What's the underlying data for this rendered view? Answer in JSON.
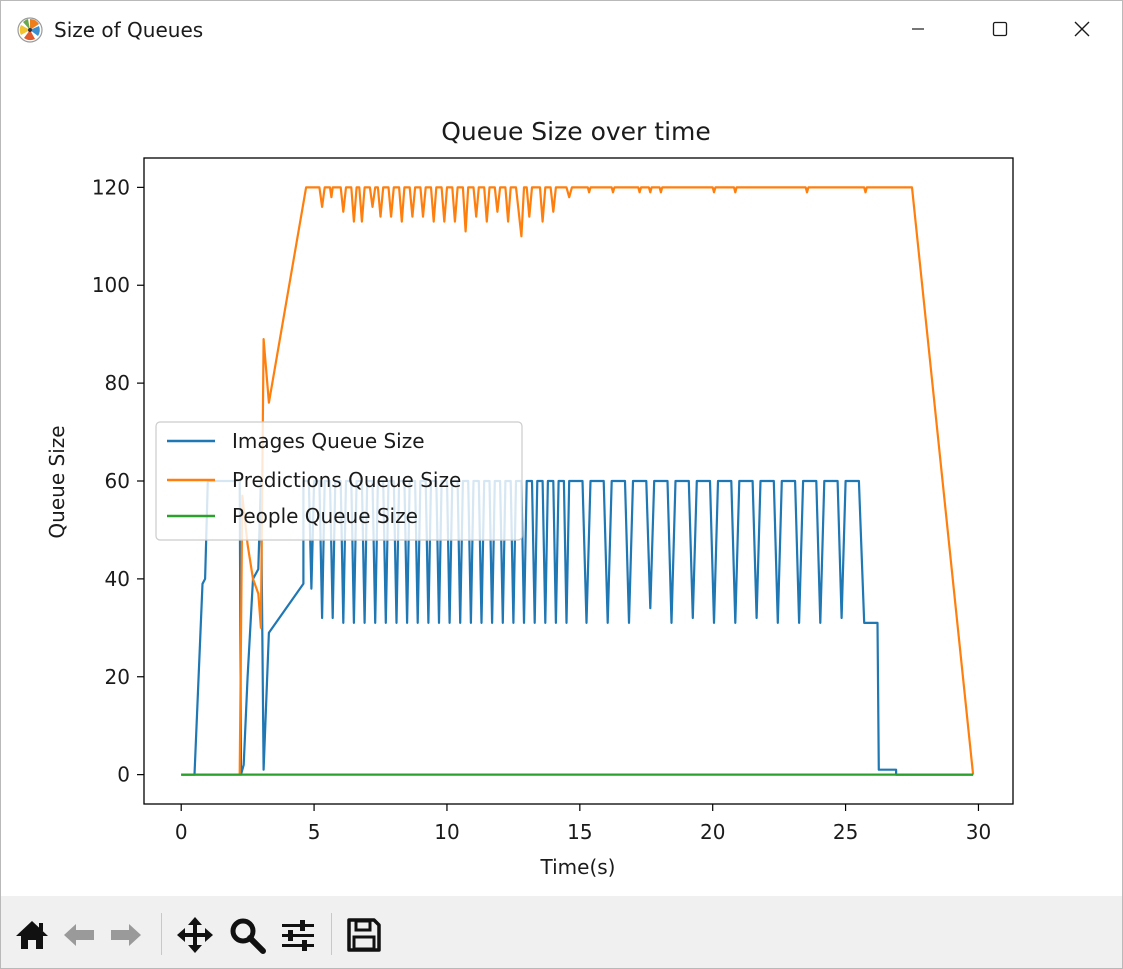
{
  "window": {
    "title": "Size of Queues",
    "controls": [
      "minimize-icon",
      "maximize-icon",
      "close-icon"
    ]
  },
  "toolbar": {
    "buttons": [
      "home-icon",
      "back-icon",
      "forward-icon",
      "pan-icon",
      "zoom-icon",
      "configure-subplots-icon",
      "save-icon"
    ]
  },
  "chart_data": {
    "type": "line",
    "title": "Queue Size over time",
    "xlabel": "Time(s)",
    "ylabel": "Queue Size",
    "xlim": [
      -1.4,
      31.3
    ],
    "ylim": [
      -6,
      126
    ],
    "xticks": [
      0,
      5,
      10,
      15,
      20,
      25,
      30
    ],
    "yticks": [
      0,
      20,
      40,
      60,
      80,
      100,
      120
    ],
    "grid": false,
    "legend": "center-left",
    "colors": {
      "images": "#1f77b4",
      "predictions": "#ff7f0e",
      "people": "#2ca02c",
      "axes": "#000000"
    },
    "series": [
      {
        "name": "Images Queue Size",
        "key": "images",
        "points": [
          [
            0,
            0
          ],
          [
            0.4,
            0
          ],
          [
            0.5,
            0
          ],
          [
            0.8,
            39
          ],
          [
            0.9,
            40
          ],
          [
            1.0,
            60
          ],
          [
            2.2,
            60
          ],
          [
            2.25,
            0
          ],
          [
            2.35,
            2
          ],
          [
            2.5,
            20
          ],
          [
            2.7,
            40
          ],
          [
            2.9,
            42
          ],
          [
            3.0,
            60
          ],
          [
            3.1,
            1
          ],
          [
            3.3,
            29
          ],
          [
            4.6,
            39
          ],
          [
            4.6,
            60
          ],
          [
            4.8,
            60
          ],
          [
            4.9,
            38
          ],
          [
            5.0,
            60
          ],
          [
            5.2,
            60
          ],
          [
            5.3,
            32
          ],
          [
            5.4,
            60
          ],
          [
            5.6,
            60
          ],
          [
            5.7,
            32
          ],
          [
            5.8,
            60
          ],
          [
            6.0,
            60
          ],
          [
            6.1,
            31
          ],
          [
            6.2,
            60
          ],
          [
            6.4,
            60
          ],
          [
            6.5,
            31
          ],
          [
            6.6,
            60
          ],
          [
            6.8,
            60
          ],
          [
            6.9,
            31
          ],
          [
            7.0,
            60
          ],
          [
            7.2,
            60
          ],
          [
            7.3,
            31
          ],
          [
            7.4,
            60
          ],
          [
            7.6,
            60
          ],
          [
            7.7,
            31
          ],
          [
            7.8,
            60
          ],
          [
            8.0,
            60
          ],
          [
            8.1,
            31
          ],
          [
            8.2,
            60
          ],
          [
            8.4,
            60
          ],
          [
            8.5,
            31
          ],
          [
            8.6,
            60
          ],
          [
            8.8,
            60
          ],
          [
            8.9,
            31
          ],
          [
            9.0,
            60
          ],
          [
            9.2,
            60
          ],
          [
            9.3,
            31
          ],
          [
            9.4,
            60
          ],
          [
            9.6,
            60
          ],
          [
            9.7,
            31
          ],
          [
            9.8,
            60
          ],
          [
            10.0,
            60
          ],
          [
            10.1,
            31
          ],
          [
            10.2,
            60
          ],
          [
            10.4,
            60
          ],
          [
            10.5,
            31
          ],
          [
            10.6,
            60
          ],
          [
            10.8,
            60
          ],
          [
            10.9,
            31
          ],
          [
            11.0,
            60
          ],
          [
            11.2,
            60
          ],
          [
            11.3,
            31
          ],
          [
            11.4,
            60
          ],
          [
            11.6,
            60
          ],
          [
            11.7,
            31
          ],
          [
            11.8,
            60
          ],
          [
            12.0,
            60
          ],
          [
            12.1,
            31
          ],
          [
            12.2,
            60
          ],
          [
            12.4,
            60
          ],
          [
            12.5,
            31
          ],
          [
            12.6,
            60
          ],
          [
            12.8,
            60
          ],
          [
            12.9,
            31
          ],
          [
            13.0,
            60
          ],
          [
            13.2,
            60
          ],
          [
            13.3,
            31
          ],
          [
            13.4,
            60
          ],
          [
            13.6,
            60
          ],
          [
            13.7,
            31
          ],
          [
            13.8,
            60
          ],
          [
            14.0,
            60
          ],
          [
            14.1,
            31
          ],
          [
            14.2,
            60
          ],
          [
            14.4,
            60
          ],
          [
            14.5,
            31
          ],
          [
            14.6,
            60
          ],
          [
            15.1,
            60
          ],
          [
            15.25,
            31
          ],
          [
            15.4,
            60
          ],
          [
            15.9,
            60
          ],
          [
            16.05,
            31
          ],
          [
            16.2,
            60
          ],
          [
            16.7,
            60
          ],
          [
            16.85,
            31
          ],
          [
            17.0,
            60
          ],
          [
            17.5,
            60
          ],
          [
            17.65,
            34
          ],
          [
            17.8,
            60
          ],
          [
            18.3,
            60
          ],
          [
            18.45,
            31
          ],
          [
            18.6,
            60
          ],
          [
            19.1,
            60
          ],
          [
            19.25,
            32
          ],
          [
            19.4,
            60
          ],
          [
            19.9,
            60
          ],
          [
            20.05,
            31
          ],
          [
            20.2,
            60
          ],
          [
            20.7,
            60
          ],
          [
            20.85,
            31
          ],
          [
            21.0,
            60
          ],
          [
            21.5,
            60
          ],
          [
            21.65,
            32
          ],
          [
            21.8,
            60
          ],
          [
            22.3,
            60
          ],
          [
            22.45,
            31
          ],
          [
            22.6,
            60
          ],
          [
            23.1,
            60
          ],
          [
            23.25,
            31
          ],
          [
            23.4,
            60
          ],
          [
            23.9,
            60
          ],
          [
            24.05,
            31
          ],
          [
            24.2,
            60
          ],
          [
            24.7,
            60
          ],
          [
            24.85,
            32
          ],
          [
            25.0,
            60
          ],
          [
            25.5,
            60
          ],
          [
            25.7,
            31
          ],
          [
            26.2,
            31
          ],
          [
            26.25,
            1
          ],
          [
            26.9,
            1
          ],
          [
            26.9,
            0
          ],
          [
            29.8,
            0
          ]
        ]
      },
      {
        "name": "Predictions Queue Size",
        "key": "predictions",
        "points": [
          [
            0,
            0
          ],
          [
            2.2,
            0
          ],
          [
            2.3,
            57
          ],
          [
            2.5,
            47
          ],
          [
            2.7,
            40
          ],
          [
            2.9,
            37
          ],
          [
            3.0,
            30
          ],
          [
            3.1,
            89
          ],
          [
            3.3,
            76
          ],
          [
            4.7,
            120
          ],
          [
            5.2,
            120
          ],
          [
            5.3,
            116
          ],
          [
            5.4,
            120
          ],
          [
            5.6,
            120
          ],
          [
            5.65,
            118
          ],
          [
            5.7,
            120
          ],
          [
            6.0,
            120
          ],
          [
            6.1,
            115
          ],
          [
            6.2,
            120
          ],
          [
            6.4,
            120
          ],
          [
            6.5,
            113
          ],
          [
            6.6,
            120
          ],
          [
            6.7,
            120
          ],
          [
            6.8,
            113
          ],
          [
            6.9,
            120
          ],
          [
            7.1,
            120
          ],
          [
            7.2,
            116
          ],
          [
            7.3,
            120
          ],
          [
            7.4,
            120
          ],
          [
            7.5,
            114
          ],
          [
            7.6,
            120
          ],
          [
            7.8,
            120
          ],
          [
            7.9,
            114
          ],
          [
            8.0,
            120
          ],
          [
            8.2,
            120
          ],
          [
            8.3,
            113
          ],
          [
            8.4,
            120
          ],
          [
            8.6,
            120
          ],
          [
            8.7,
            114
          ],
          [
            8.8,
            120
          ],
          [
            9.0,
            120
          ],
          [
            9.1,
            114
          ],
          [
            9.2,
            120
          ],
          [
            9.4,
            120
          ],
          [
            9.5,
            113
          ],
          [
            9.6,
            120
          ],
          [
            9.8,
            120
          ],
          [
            9.9,
            113
          ],
          [
            10.0,
            120
          ],
          [
            10.2,
            120
          ],
          [
            10.3,
            113
          ],
          [
            10.4,
            120
          ],
          [
            10.6,
            120
          ],
          [
            10.7,
            111
          ],
          [
            10.8,
            120
          ],
          [
            11.0,
            120
          ],
          [
            11.1,
            114
          ],
          [
            11.2,
            120
          ],
          [
            11.4,
            120
          ],
          [
            11.5,
            113
          ],
          [
            11.6,
            120
          ],
          [
            11.8,
            120
          ],
          [
            11.9,
            115
          ],
          [
            12.0,
            120
          ],
          [
            12.2,
            120
          ],
          [
            12.3,
            113
          ],
          [
            12.4,
            120
          ],
          [
            12.6,
            120
          ],
          [
            12.7,
            115
          ],
          [
            12.8,
            110
          ],
          [
            12.9,
            120
          ],
          [
            13.0,
            120
          ],
          [
            13.1,
            114
          ],
          [
            13.2,
            120
          ],
          [
            13.5,
            120
          ],
          [
            13.6,
            113
          ],
          [
            13.7,
            120
          ],
          [
            13.9,
            120
          ],
          [
            14.0,
            115
          ],
          [
            14.1,
            120
          ],
          [
            14.5,
            120
          ],
          [
            14.6,
            118
          ],
          [
            14.7,
            120
          ],
          [
            15.3,
            120
          ],
          [
            15.35,
            119
          ],
          [
            15.4,
            120
          ],
          [
            16.2,
            120
          ],
          [
            16.25,
            119
          ],
          [
            16.3,
            120
          ],
          [
            17.2,
            120
          ],
          [
            17.25,
            119
          ],
          [
            17.3,
            120
          ],
          [
            17.6,
            120
          ],
          [
            17.65,
            119
          ],
          [
            17.7,
            120
          ],
          [
            18.0,
            120
          ],
          [
            18.05,
            119
          ],
          [
            18.1,
            120
          ],
          [
            20.0,
            120
          ],
          [
            20.05,
            119
          ],
          [
            20.1,
            120
          ],
          [
            20.8,
            120
          ],
          [
            20.85,
            119
          ],
          [
            20.9,
            120
          ],
          [
            23.5,
            120
          ],
          [
            23.55,
            119
          ],
          [
            23.6,
            120
          ],
          [
            25.7,
            120
          ],
          [
            25.75,
            119
          ],
          [
            25.8,
            120
          ],
          [
            27.5,
            120
          ],
          [
            29.8,
            0
          ]
        ]
      },
      {
        "name": "People Queue Size",
        "key": "people",
        "points": [
          [
            0,
            0
          ],
          [
            29.8,
            0
          ]
        ]
      }
    ]
  }
}
